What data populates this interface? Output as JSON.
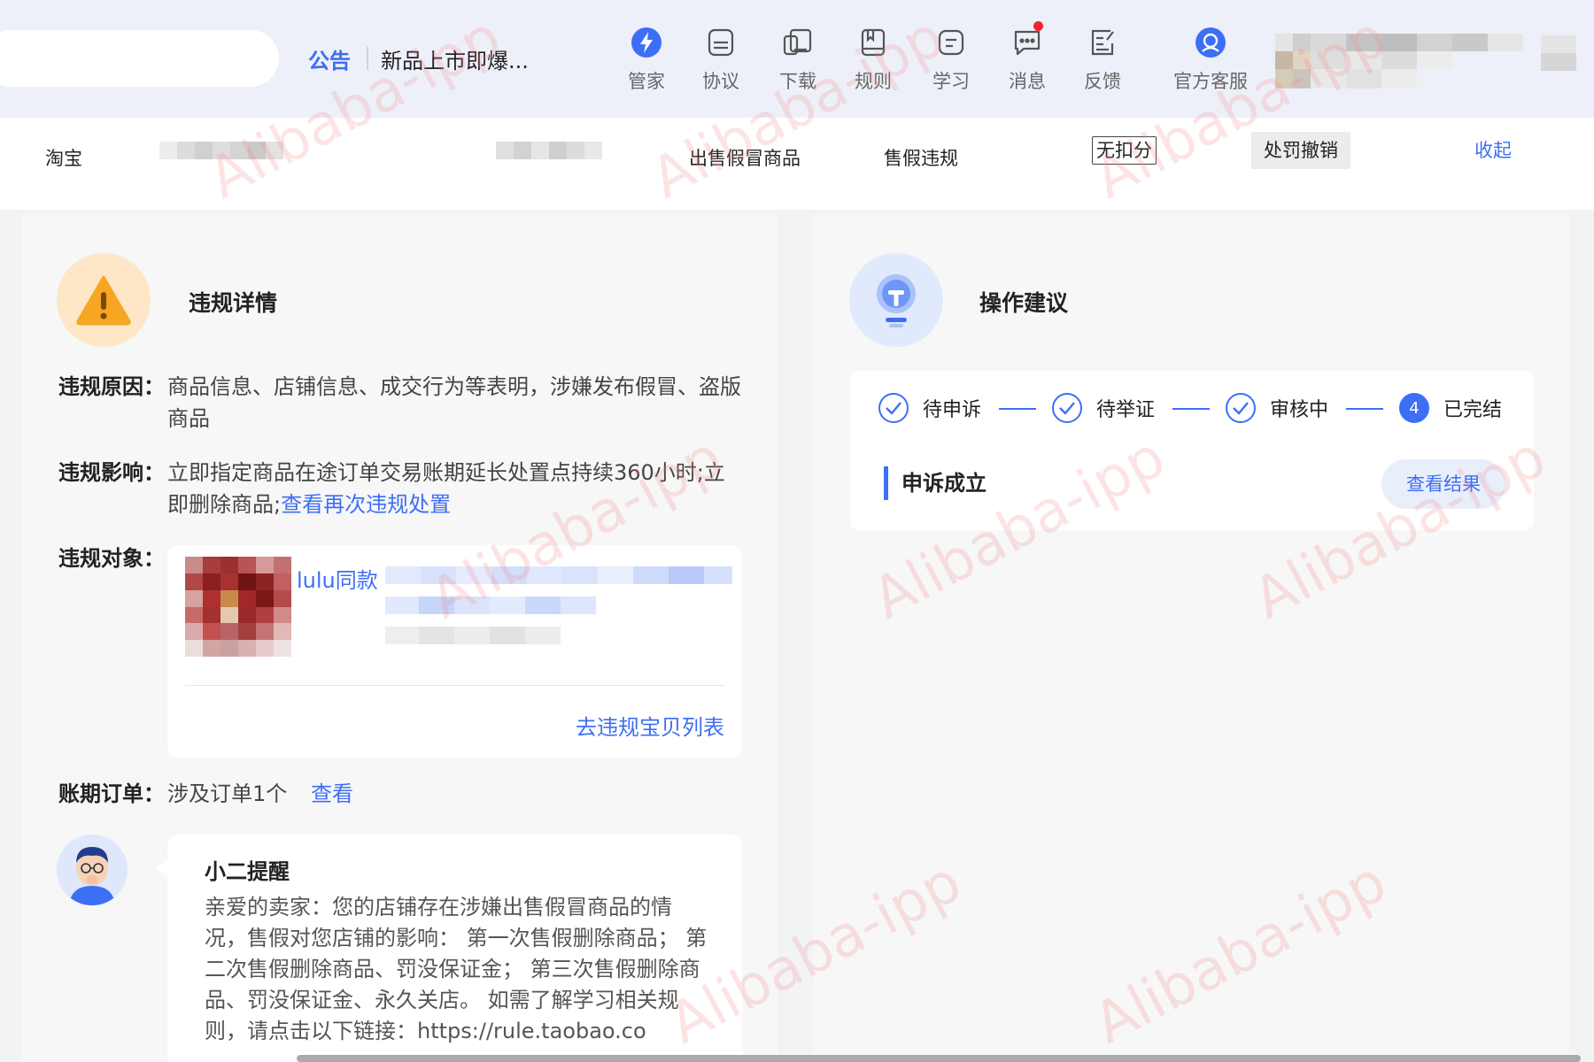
{
  "header": {
    "notice_tag": "公告",
    "notice_text": "新品上市即爆...",
    "nav": [
      {
        "label": "管家",
        "icon": "lightning-icon"
      },
      {
        "label": "协议",
        "icon": "agreement-icon"
      },
      {
        "label": "下载",
        "icon": "download-icon"
      },
      {
        "label": "规则",
        "icon": "rules-book-icon"
      },
      {
        "label": "学习",
        "icon": "learn-icon"
      },
      {
        "label": "消息",
        "icon": "message-icon"
      },
      {
        "label": "反馈",
        "icon": "feedback-icon"
      },
      {
        "label": "官方客服",
        "icon": "customer-service-icon"
      }
    ]
  },
  "subbar": {
    "platform": "淘宝",
    "violation_type": "出售假冒商品",
    "violation_category": "售假违规",
    "no_deduct": "无扣分",
    "penalty_status": "处罚撤销",
    "collapse": "收起"
  },
  "detail": {
    "title": "违规详情",
    "reason_label": "违规原因：",
    "reason_value": "商品信息、店铺信息、成交行为等表明，涉嫌发布假冒、盗版商品",
    "impact_label": "违规影响：",
    "impact_value": "立即指定商品在途订单交易账期延长处置点持续360小时;立即删除商品;",
    "impact_link": "查看再次违规处置",
    "object_label": "违规对象：",
    "object_title": "lulu同款",
    "object_link": "去违规宝贝列表",
    "order_label": "账期订单：",
    "order_value": "涉及订单1个",
    "order_link": "查看"
  },
  "reminder": {
    "title": "小二提醒",
    "text": "亲爱的卖家：您的店铺存在涉嫌出售假冒商品的情况，售假对您店铺的影响： 第一次售假删除商品； 第二次售假删除商品、罚没保证金； 第三次售假删除商品、罚没保证金、永久关店。 如需了解学习相关规则，请点击以下链接：https://rule.taobao.co"
  },
  "advice": {
    "title": "操作建议",
    "steps": [
      {
        "label": "待申诉",
        "state": "done"
      },
      {
        "label": "待举证",
        "state": "done"
      },
      {
        "label": "审核中",
        "state": "done"
      },
      {
        "label": "已完结",
        "state": "current",
        "number": "4"
      }
    ],
    "result_title": "申诉成立",
    "result_button": "查看结果"
  },
  "watermark": "Alibaba-ipp",
  "colors": {
    "accent": "#3d6ff5",
    "warning": "#f6a623",
    "panel_bg": "#f7f7f7"
  }
}
